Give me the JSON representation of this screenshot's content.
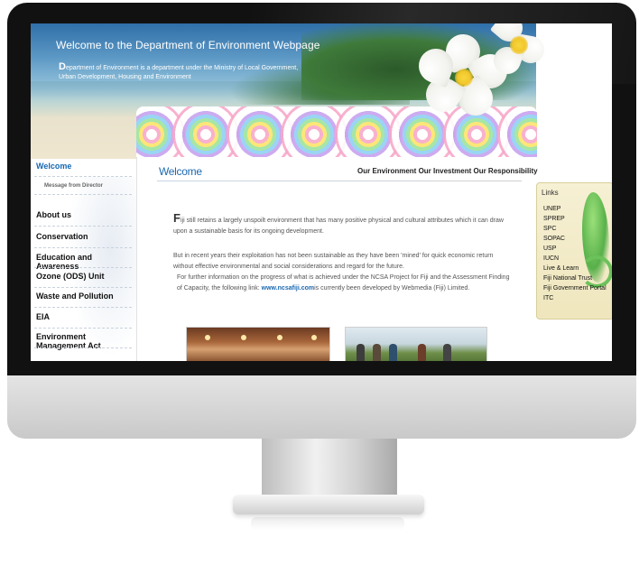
{
  "header": {
    "title": "Welcome to the Department of Environment Webpage",
    "desc_dropcap": "D",
    "desc_rest": "epartment of Environment  is  a department under the Ministry of Local Government, Urban Development, Housing and Environment"
  },
  "nav": {
    "items": [
      {
        "label": "Welcome",
        "active": true
      },
      {
        "label": "About us"
      },
      {
        "label": "Conservation"
      },
      {
        "label": "Education and Awareness"
      },
      {
        "label": "Ozone (ODS) Unit"
      },
      {
        "label": "Waste and Pollution"
      },
      {
        "label": "EIA"
      },
      {
        "label": "Environment Management Act"
      }
    ],
    "sub_label": "Message from Director"
  },
  "main": {
    "heading": "Welcome",
    "tagline": "Our Environment Our Investment Our Responsibility",
    "p1_dropcap": "F",
    "p1_rest": "iji still retains a largely unspoilt environment that has many positive physical and cultural attributes which it can draw upon a sustainable basis for its ongoing development.",
    "p2": "But in recent years their exploitation has not been sustainable as they have been 'mined' for quick economic return without effective environmental and social considerations and regard for the future.",
    "p3_before": "For further information on the progress of what is achieved under the NCSA Project for Fiji and the Assessment Finding of Capacity, the following link: ",
    "p3_link": "www.ncsafiji.com",
    "p3_after": "is currently been developed by Webmedia (Fiji) Limited."
  },
  "links": {
    "title": "Links",
    "items": [
      "UNEP",
      "SPREP",
      "SPC",
      "SOPAC",
      "USP",
      "IUCN",
      "Live & Learn",
      "Fiji National Trust",
      "Fiji Government Portal",
      "ITC"
    ]
  }
}
